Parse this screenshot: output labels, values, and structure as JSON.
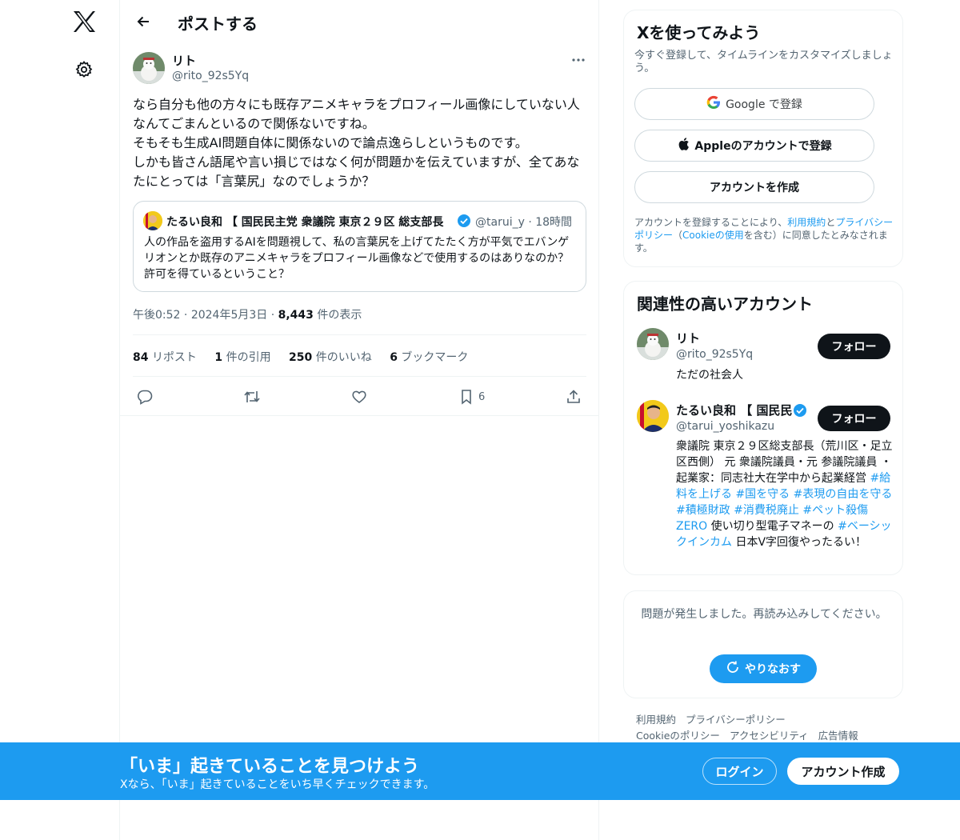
{
  "header": {
    "title": "ポストする"
  },
  "tweet": {
    "author_name": "リト",
    "author_handle": "@rito_92s5Yq",
    "text": "なら自分も他の方々にも既存アニメキャラをプロフィール画像にしていない人なんてごまんといるので関係ないですね。\nそもそも生成AI問題自体に関係ないので論点逸らしというものです。\nしかも皆さん語尾や言い損じではなく何が問題かを伝えていますが、全てあなたにとっては「言葉尻」なのでしょうか？",
    "time": "午後0:52",
    "date": "2024年5月3日",
    "views": "8,443",
    "views_label": "件の表示",
    "stats": {
      "reposts": "84",
      "reposts_label": "リポスト",
      "quotes": "1",
      "quotes_label": "件の引用",
      "likes": "250",
      "likes_label": "件のいいね",
      "bookmarks": "6",
      "bookmarks_label": "ブックマーク"
    },
    "bookmark_count": "6"
  },
  "quote": {
    "name": "たるい良和 【 国民民主党 衆議院 東京２９区 総支部長",
    "handle": "@tarui_y",
    "time": "· 18時間",
    "text": "人の作品を盗用するAIを問題視して、私の言葉尻を上げてたたく方が平気でエバンゲリオンとか既存のアニメキャラをプロフィール画像などで使用するのはありなのか？許可を得ているということ？"
  },
  "signup": {
    "title": "Xを使ってみよう",
    "subtitle": "今すぐ登録して、タイムラインをカスタマイズしましょう。",
    "google": "Google で登録",
    "apple": "Appleのアカウントで登録",
    "create": "アカウントを作成",
    "terms_1": "アカウントを登録することにより、",
    "terms_link1": "利用規約",
    "terms_2": "と",
    "terms_link2": "プライバシーポリシー",
    "terms_3": "（",
    "terms_link3": "Cookieの使用",
    "terms_4": "を含む）に同意したとみなされます。"
  },
  "related": {
    "title": "関連性の高いアカウント",
    "follow_label": "フォロー",
    "accounts": [
      {
        "name": "リト",
        "handle": "@rito_92s5Yq",
        "bio": "ただの社会人"
      },
      {
        "name": "たるい良和 【 国民民",
        "handle": "@tarui_yoshikazu",
        "bio_1": "衆議院 東京２９区総支部長（荒川区・足立区西側） 元 衆議院議員・元 参議院議員 ・起業家：同志社大在学中から起業経営 ",
        "tag1": "#給料を上げる",
        "tag2": "#国を守る",
        "tag3": "#表現の自由を守る",
        "tag4": "#積極財政",
        "tag5": "#消費税廃止",
        "tag6": "#ペット殺傷ZERO",
        "bio_2": " 使い切り型電子マネーの ",
        "tag7": "#ベーシックインカム",
        "bio_3": " 日本V字回復やったるい！"
      }
    ]
  },
  "error": {
    "text": "問題が発生しました。再読み込みしてください。",
    "retry": "やりなおす"
  },
  "footer": {
    "links": [
      "利用規約",
      "プライバシーポリシー",
      "Cookieのポリシー",
      "アクセシビリティ",
      "広告情報"
    ]
  },
  "banner": {
    "title": "「いま」起きていることを見つけよう",
    "subtitle": "Xなら、「いま」起きていることをいち早くチェックできます。",
    "login": "ログイン",
    "signup": "アカウント作成"
  },
  "colors": {
    "accent": "#1d9bf0",
    "text": "#0f1419",
    "muted": "#536471"
  },
  "icons": [
    "x-logo-icon",
    "gear-icon",
    "back-arrow-icon",
    "more-icon",
    "verified-icon",
    "reply-icon",
    "repost-icon",
    "like-icon",
    "bookmark-icon",
    "share-icon",
    "google-icon",
    "apple-icon",
    "refresh-icon"
  ]
}
